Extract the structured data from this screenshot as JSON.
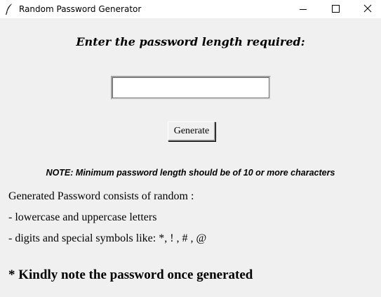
{
  "window": {
    "title": "Random Password Generator",
    "icon": "feather-icon",
    "controls": [
      "minimize-icon",
      "maximize-icon",
      "close-icon"
    ]
  },
  "form": {
    "heading": "Enter the password length required:",
    "length_input": {
      "value": "",
      "placeholder": ""
    },
    "generate_label": "Generate"
  },
  "note": "NOTE: Minimum password length should be of 10 or more characters",
  "info": {
    "line1": "Generated Password consists of random :",
    "line2": "- lowercase and uppercase letters",
    "line3": "- digits and special symbols like: *, ! , # , @"
  },
  "reminder": "* Kindly note the password once generated"
}
